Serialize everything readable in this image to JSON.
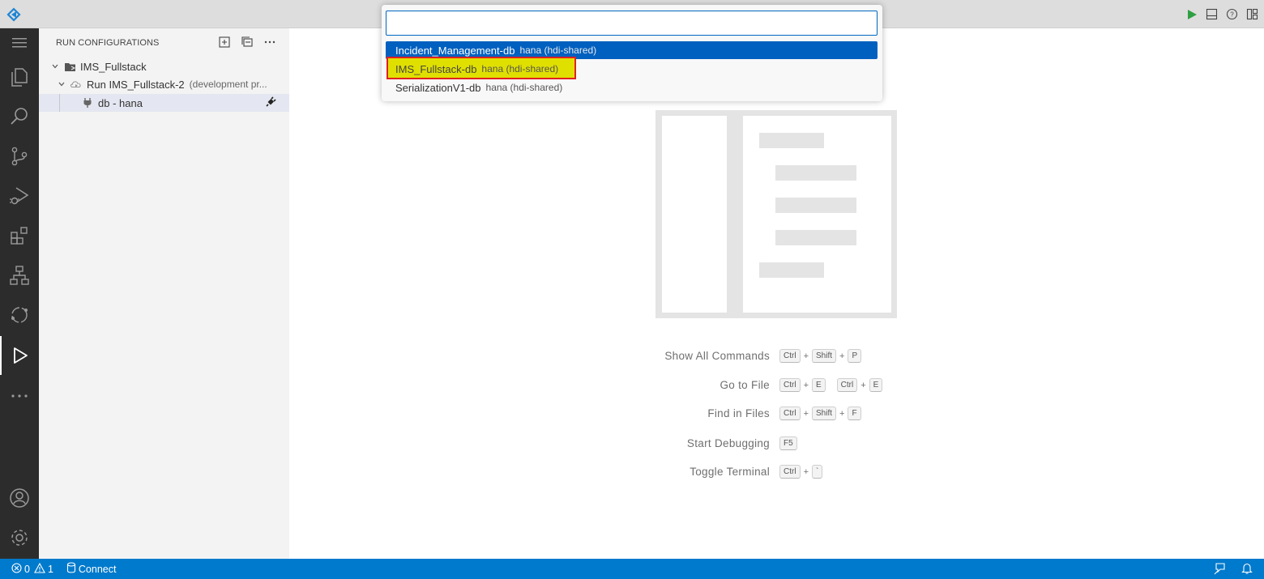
{
  "titlebar": {
    "actions": [
      {
        "icon": "run-icon",
        "color": "#2ea043"
      },
      {
        "icon": "panel-icon"
      },
      {
        "icon": "help-icon"
      },
      {
        "icon": "layout-icon"
      }
    ]
  },
  "activitybar": {
    "items": [
      "menu-icon",
      "explorer-icon",
      "search-icon",
      "source-control-icon",
      "run-debug-icon",
      "extensions-icon",
      "hierarchy-icon",
      "cloud-icon",
      "run-configurations-icon",
      "more-icon"
    ],
    "bottom": [
      "account-icon",
      "settings-icon"
    ],
    "active": "run-configurations-icon"
  },
  "sidebar": {
    "title": "RUN CONFIGURATIONS",
    "tree": {
      "root": {
        "label": "IMS_Fullstack"
      },
      "child": {
        "label": "Run IMS_Fullstack-2",
        "description": "(development pr..."
      },
      "leaf": {
        "label": "db - hana"
      }
    }
  },
  "quickpick": {
    "input_value": "",
    "items": [
      {
        "label": "Incident_Management-db",
        "description": "hana (hdi-shared)",
        "state": "focused"
      },
      {
        "label": "IMS_Fullstack-db",
        "description": "hana (hdi-shared)",
        "state": "highlighted"
      },
      {
        "label": "SerializationV1-db",
        "description": "hana (hdi-shared)",
        "state": "normal"
      }
    ]
  },
  "shortcuts": [
    {
      "label": "Show All Commands",
      "keys": [
        "Ctrl",
        "+",
        "Shift",
        "+",
        "P"
      ]
    },
    {
      "label": "Go to File",
      "keys": [
        "Ctrl",
        "+",
        "E",
        " ",
        "Ctrl",
        "+",
        "E"
      ]
    },
    {
      "label": "Find in Files",
      "keys": [
        "Ctrl",
        "+",
        "Shift",
        "+",
        "F"
      ]
    },
    {
      "label": "Start Debugging",
      "keys": [
        "F5"
      ]
    },
    {
      "label": "Toggle Terminal",
      "keys": [
        "Ctrl",
        "+",
        "`"
      ]
    }
  ],
  "statusbar": {
    "errors": "0",
    "warnings": "1",
    "connect": "Connect",
    "color": "#007acc"
  }
}
